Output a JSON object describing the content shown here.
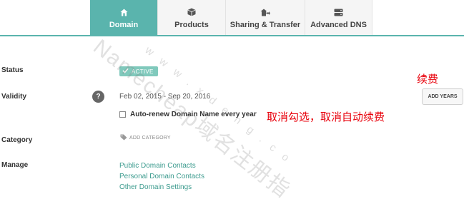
{
  "tabs": [
    {
      "label": "Domain",
      "icon": "house-icon",
      "active": true
    },
    {
      "label": "Products",
      "icon": "box-icon",
      "active": false
    },
    {
      "label": "Sharing & Transfer",
      "icon": "transfer-icon",
      "active": false
    },
    {
      "label": "Advanced DNS",
      "icon": "server-icon",
      "active": false
    }
  ],
  "status": {
    "label": "Status",
    "badge": "ACTIVE"
  },
  "validity": {
    "label": "Validity",
    "help": "?",
    "dates": "Feb 02, 2015 - Sep 20, 2016",
    "autorenew_label": "Auto-renew Domain Name every year",
    "autorenew_checked": false,
    "add_years_button": "ADD YEARS"
  },
  "category": {
    "label": "Category",
    "add_label": "ADD CATEGORY"
  },
  "manage": {
    "label": "Manage",
    "links": [
      "Public Domain Contacts",
      "Personal Domain Contacts",
      "Other Domain Settings"
    ]
  },
  "annotations": {
    "renew": "续费",
    "cancel": "取消勾选，取消自动续费"
  },
  "watermark": {
    "text": "Namecheap域名注册指",
    "sub": "www.xdeng.co"
  },
  "colors": {
    "accent": "#5ab4ad",
    "badge": "#80c9bc",
    "link": "#3c9b8e",
    "annotation": "#e8000b"
  }
}
